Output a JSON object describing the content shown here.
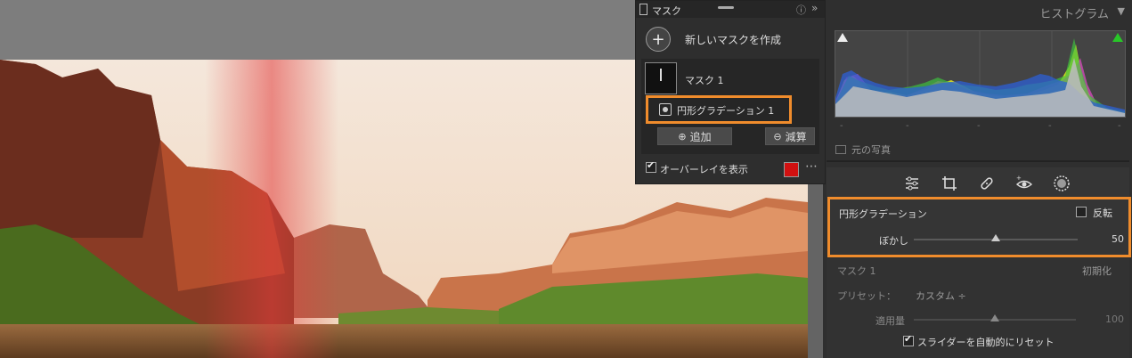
{
  "histogram": {
    "title": "ヒストグラム",
    "tick_labels": [
      "-",
      "-",
      "-",
      "-",
      "-"
    ],
    "original_photo_label": "元の写真"
  },
  "tools": [
    "adjust-icon",
    "crop-icon",
    "heal-icon",
    "redeye-icon",
    "radial-icon"
  ],
  "gradient_panel": {
    "title": "円形グラデーション",
    "invert_label": "反転",
    "invert_checked": false,
    "feather_label": "ぼかし",
    "feather_value": "50",
    "feather_level": 0.5
  },
  "mask_panel": {
    "title": "マスク 1",
    "reset_label": "初期化",
    "preset_label": "プリセット：",
    "preset_value": "カスタム ÷",
    "amount_label": "適用量",
    "amount_value": "100",
    "amount_level": 0.5,
    "auto_reset_label": "スライダーを自動的にリセット",
    "auto_reset_checked": true
  },
  "mask_popup": {
    "title": "マスク",
    "new_mask_label": "新しいマスクを作成",
    "mask_item_label": "マスク 1",
    "gradient_item_label": "円形グラデーション 1",
    "add_label": "追加",
    "subtract_label": "減算",
    "overlay_label": "オーバーレイを表示",
    "overlay_checked": true,
    "overlay_color": "#d11111"
  },
  "colors": {
    "highlight": "#f08c2c"
  }
}
